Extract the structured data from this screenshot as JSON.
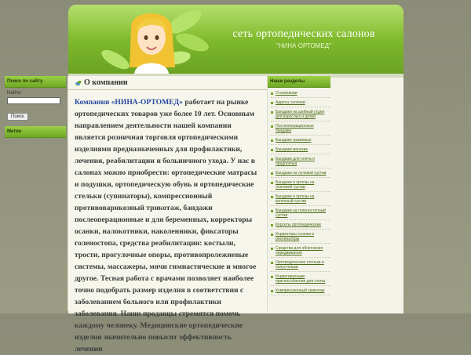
{
  "header": {
    "title": "сеть ортопедических салонов",
    "subtitle": "\"НИНА ОРТОМЕД\""
  },
  "sidebar_left": {
    "search_title": "Поиск по сайту",
    "find_label": "Найти:",
    "search_value": "",
    "search_button": "Поиск",
    "tags_title": "Метки"
  },
  "main": {
    "title": "О компании",
    "brand": "Компания «НИНА-ОРТОМЕД»",
    "body": " работает на рынке ортопедических товаров уже более 10 лет. Основным направлением деятельности нашей компании является розничная торговля ортопедическими изделиями предназначенных для профилактики, лечения, реабилитации и больничного ухода. У нас в салонах можно приобрести: ортопедические матрасы и подушки, ортопедическую обувь и ортопедические стельки (супинаторы), компрессионный противоварикозный трикотаж, бандажи послеоперационные и для беременных, корректоры осанки, налокотники, наколенники, фиксаторы голеностопа, средства реабилитации: костыли, трости, прогулочные опоры, противопролежневые системы, массажеры, мячи гимнастические и многое другое. Тесная работа с врачами позволяет наиболее точно подобрать размер изделия в соответствии с заболеванием больного или профилактики заболевания. Наши продавцы стремятся помочь каждому человеку. Медицинские ортопедические изделия значительно повысят эффективность лечения"
  },
  "sidebar_right": {
    "title": "Наши разделы",
    "items": [
      "О компании",
      "Адреса салонов",
      "Бандажи на шейный отдел для взрослых и детей",
      "Послеоперационные бандажи",
      "Бандажи грыжевые",
      "Бандажи женские",
      "Бандажи для плеча и предплечья",
      "Бандажи на лучевой сустав",
      "Бандажи и ортезы на локтевой сустав",
      "Бандажи и ортезы на коленный сустав",
      "Бандажи на голеностопный сустав",
      "Корсеты ортопедические",
      "Корректоры осанки и реклинаторы",
      "Средства для облегчения передвижения",
      "Ортопедические стельки и полустельки",
      "Корригирующие приспособления для стопы",
      "Компрессионный трикотаж"
    ]
  }
}
